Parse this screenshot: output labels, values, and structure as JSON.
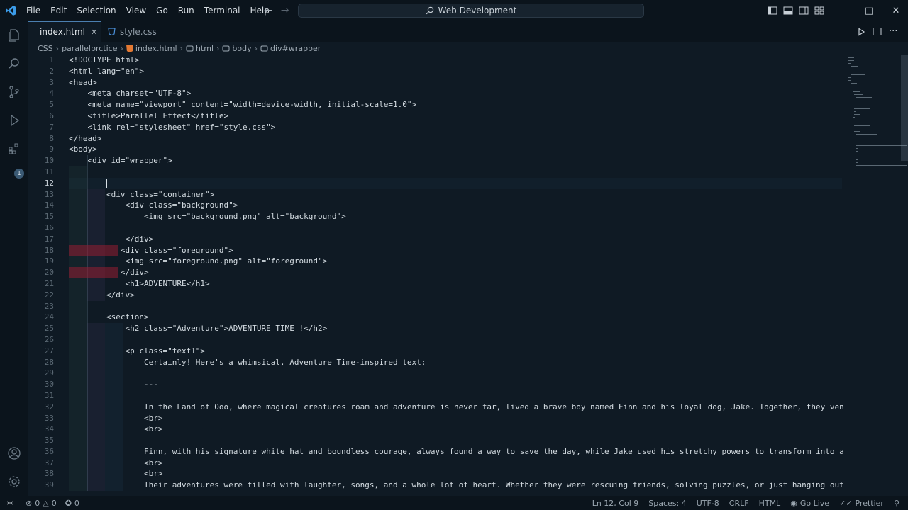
{
  "menu": [
    "File",
    "Edit",
    "Selection",
    "View",
    "Go",
    "Run",
    "Terminal",
    "Help"
  ],
  "command_center": {
    "text": "Web Development"
  },
  "tabs": [
    {
      "label": "index.html",
      "active": true
    },
    {
      "label": "style.css",
      "active": false
    }
  ],
  "breadcrumb": [
    "CSS",
    "parallelprctice",
    "index.html",
    "html",
    "body",
    "div#wrapper"
  ],
  "activity_badge": "1",
  "editor": {
    "line_numbers": [
      "1",
      "2",
      "3",
      "4",
      "5",
      "6",
      "7",
      "8",
      "9",
      "10",
      "11",
      "12",
      "13",
      "14",
      "15",
      "16",
      "17",
      "18",
      "19",
      "20",
      "21",
      "22",
      "23",
      "24",
      "25",
      "26",
      "27",
      "28",
      "29",
      "30",
      "31",
      "32",
      "33",
      "34",
      "35",
      "36",
      "37",
      "38",
      "39"
    ],
    "lines": [
      "<!DOCTYPE html>",
      "<html lang=\"en\">",
      "<head>",
      "    <meta charset=\"UTF-8\">",
      "    <meta name=\"viewport\" content=\"width=device-width, initial-scale=1.0\">",
      "    <title>Parallel Effect</title>",
      "    <link rel=\"stylesheet\" href=\"style.css\">",
      "</head>",
      "<body>",
      "    <div id=\"wrapper\">",
      "",
      "        ",
      "        <div class=\"container\">",
      "            <div class=\"background\">",
      "                <img src=\"background.png\" alt=\"background\">",
      "",
      "            </div>",
      "           <div class=\"foreground\">",
      "            <img src=\"foreground.png\" alt=\"foreground\">",
      "           </div>",
      "            <h1>ADVENTURE</h1>",
      "        </div>",
      "",
      "        <section>",
      "            <h2 class=\"Adventure\">ADVENTURE TIME !</h2>",
      "",
      "            <p class=\"text1\">",
      "                Certainly! Here's a whimsical, Adventure Time-inspired text:",
      "",
      "                ---",
      "",
      "                In the Land of Ooo, where magical creatures roam and adventure is never far, lived a brave boy named Finn and his loyal dog, Jake. Together, they ventured",
      "                <br>",
      "                <br>",
      "",
      "                Finn, with his signature white hat and boundless courage, always found a way to save the day, while Jake used his stretchy powers to transform into anythi",
      "                <br>",
      "                <br>",
      "                Their adventures were filled with laughter, songs, and a whole lot of heart. Whether they were rescuing friends, solving puzzles, or just hanging out by t"
    ]
  },
  "status": {
    "errors": "0",
    "warnings": "0",
    "ports": "0",
    "position": "Ln 12, Col 9",
    "spaces": "Spaces: 4",
    "encoding": "UTF-8",
    "eol": "CRLF",
    "language": "HTML",
    "golive": "Go Live",
    "prettier": "Prettier"
  },
  "colors": {
    "background": "#0f1a24",
    "chrome": "#0b141c",
    "error_highlight": "#7a1e30"
  }
}
